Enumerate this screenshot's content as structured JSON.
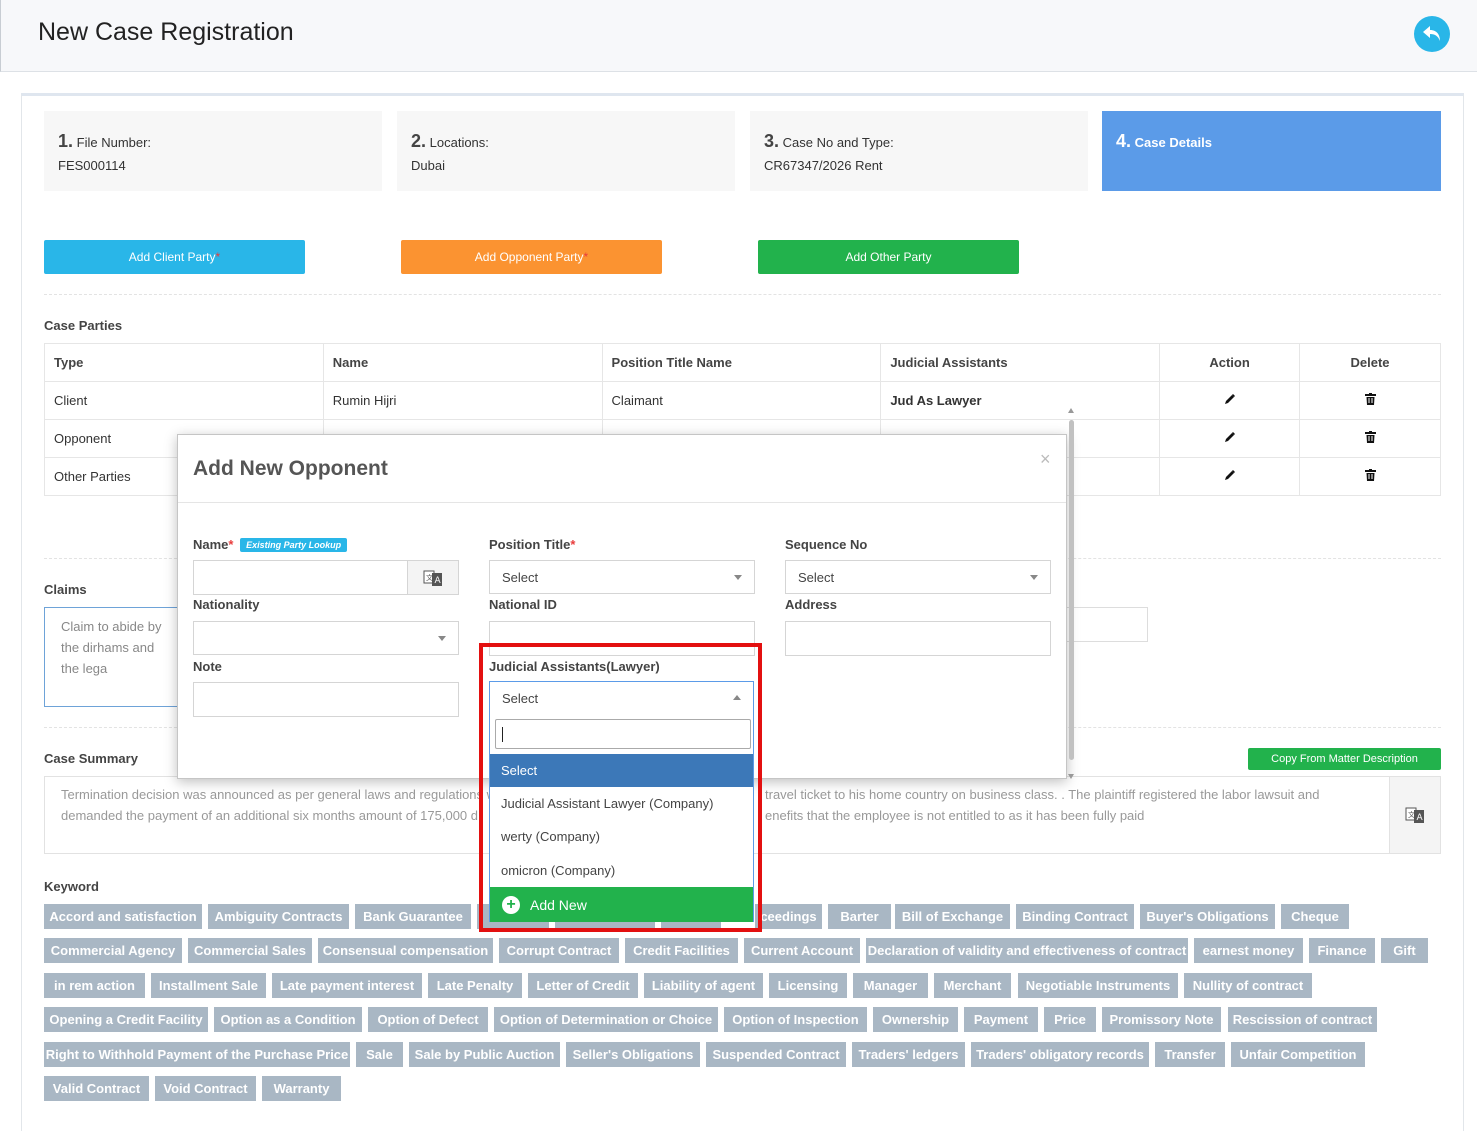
{
  "header": {
    "title": "New Case Registration",
    "back_icon": "reply-icon"
  },
  "steps": [
    {
      "num": "1.",
      "label": "File Number:",
      "value": "FES000114"
    },
    {
      "num": "2.",
      "label": "Locations:",
      "value": "Dubai"
    },
    {
      "num": "3.",
      "label": "Case No and Type:",
      "value": "CR67347/2026 Rent"
    },
    {
      "num": "4.",
      "label": "Case Details",
      "value": ""
    }
  ],
  "party_buttons": {
    "client": "Add Client Party",
    "opponent": "Add Opponent Party",
    "other": "Add Other Party",
    "required_mark": "*"
  },
  "case_parties": {
    "label": "Case Parties",
    "columns": [
      "Type",
      "Name",
      "Position Title Name",
      "Judicial Assistants",
      "Action",
      "Delete"
    ],
    "rows": [
      {
        "type": "Client",
        "name": "Rumin Hijri",
        "position": "Claimant",
        "assistant": "Jud As Lawyer"
      },
      {
        "type": "Opponent",
        "name": "",
        "position": "",
        "assistant": ""
      },
      {
        "type": "Other Parties",
        "name": "",
        "position": "",
        "assistant": ""
      }
    ]
  },
  "claims": {
    "label": "Claims",
    "text": "Claim to abide by the dirhams and the lega"
  },
  "case_summary": {
    "label": "Case Summary",
    "copy_button": "Copy From Matter Description",
    "line1_left": "Termination decision was announced as per general laws and regulations wi",
    "line1_right": "travel ticket to his home country on business class. . The plaintiff registered the labor lawsuit and",
    "line2_left": "demanded the payment of an additional six months amount of 175,000 d",
    "line2_right": "enefits that the employee is not entitled to as it has been fully paid"
  },
  "keywords": {
    "label": "Keyword",
    "rows": [
      [
        "Accord and satisfaction",
        "Ambiguity Contracts",
        "Bank Guarantee",
        "",
        "",
        "",
        "ceedings",
        "Barter",
        "Bill of Exchange",
        "Binding Contract",
        "Buyer's Obligations",
        "Cheque"
      ],
      [
        "Commercial Agency",
        "Commercial Sales",
        "Consensual compensation",
        "Corrupt Contract",
        "Credit Facilities",
        "Current Account",
        "Declaration of validity and effectiveness of contract",
        "earnest money",
        "Finance",
        "Gift"
      ],
      [
        "in rem action",
        "Installment Sale",
        "Late payment interest",
        "Late Penalty",
        "Letter of Credit",
        "Liability of agent",
        "Licensing",
        "Manager",
        "Merchant",
        "Negotiable Instruments",
        "Nullity of contract"
      ],
      [
        "Opening a Credit Facility",
        "Option as a Condition",
        "Option of Defect",
        "Option of Determination or Choice",
        "Option of Inspection",
        "Ownership",
        "Payment",
        "Price",
        "Promissory Note",
        "Rescission of contract"
      ],
      [
        "Right to Withhold Payment of the Purchase Price",
        "Sale",
        "Sale by Public Auction",
        "Seller's Obligations",
        "Suspended Contract",
        "Traders' ledgers",
        "Traders' obligatory records",
        "Transfer",
        "Unfair Competition"
      ],
      [
        "Valid Contract",
        "Void Contract",
        "Warranty"
      ]
    ]
  },
  "modal": {
    "title": "Add New Opponent",
    "close": "×",
    "name_label": "Name",
    "lookup_badge": "Existing Party Lookup",
    "position_label": "Position Title",
    "position_value": "Select",
    "sequence_label": "Sequence No",
    "sequence_value": "Select",
    "nationality_label": "Nationality",
    "national_id_label": "National ID",
    "address_label": "Address",
    "note_label": "Note",
    "judicial_label": "Judicial Assistants(Lawyer)",
    "judicial_value": "Select",
    "required_mark": "*"
  },
  "dropdown": {
    "options": [
      "Select",
      "Judicial Assistant Lawyer (Company)",
      "werty (Company)",
      "omicron (Company)"
    ],
    "add_new": "Add New"
  },
  "colors": {
    "client_btn": "#29b6e8",
    "opponent_btn": "#fb9331",
    "other_btn": "#22b24c",
    "active_step": "#5b9be8",
    "highlight": "#e31010"
  }
}
